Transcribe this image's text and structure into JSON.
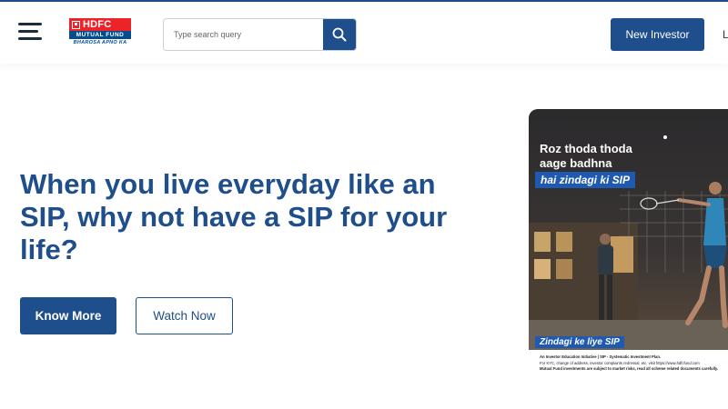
{
  "header": {
    "logo": {
      "brand": "HDFC",
      "subtitle": "MUTUAL FUND",
      "tagline": "BHAROSA APNO KA"
    },
    "search": {
      "placeholder": "Type search query"
    },
    "new_investor_label": "New Investor",
    "login_partial": "L",
    "icons": {
      "menu": "hamburger-menu-icon",
      "search": "search-icon"
    }
  },
  "hero": {
    "headline": "When you live everyday like an SIP, why not have a SIP for your life?",
    "know_more_label": "Know More",
    "watch_now_label": "Watch Now"
  },
  "banner": {
    "line1": "Roz thoda thoda",
    "line2": "aage badhna",
    "highlight": "hai zindagi ki SIP",
    "tagline": "Zindagi ke liye SIP",
    "fine_print_1": "An Investor Education Initiative | SIP - Systematic Investment Plan.",
    "fine_print_2": "For KYC, change of address, investor complaints redressal, etc. visit https://www.hdfcfund.com",
    "fine_print_3": "Mutual Fund investments are subject to market risks, read all scheme related documents carefully."
  },
  "colors": {
    "primary": "#1f4e8c",
    "logo_red": "#ed232a",
    "logo_blue": "#004c8f"
  }
}
